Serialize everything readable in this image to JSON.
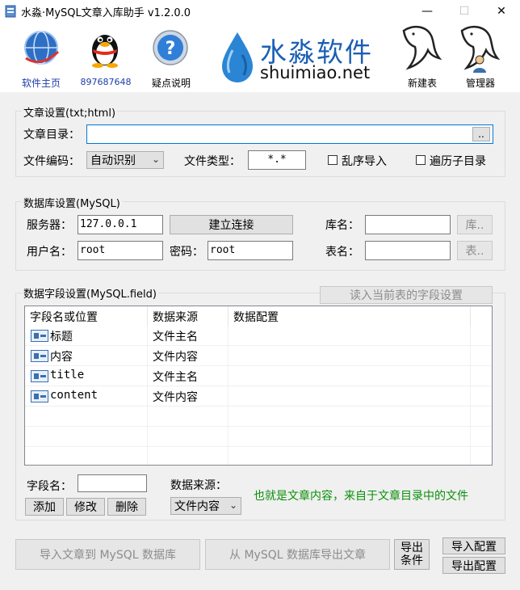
{
  "window": {
    "title": "水淼·MySQL文章入库助手 v1.2.0.0",
    "minimize": "—",
    "maximize": "☐",
    "close": "✕"
  },
  "toolbar": {
    "home_label": "软件主页",
    "qq_label": "897687648",
    "help_label": "疑点说明",
    "brand_cn": "水淼软件",
    "brand_en": "shuimiao.net",
    "new_table_label": "新建表",
    "manager_label": "管理器"
  },
  "article": {
    "group_title": "文章设置(txt;html)",
    "dir_label": "文章目录：",
    "dir_value": "",
    "browse_label": "..",
    "encoding_label": "文件编码：",
    "encoding_value": "自动识别",
    "type_label": "文件类型：",
    "type_value": "*.*",
    "random_label": "乱序导入",
    "subdir_label": "遍历子目录"
  },
  "database": {
    "group_title": "数据库设置(MySQL)",
    "server_label": "服务器：",
    "server_value": "127.0.0.1",
    "connect_label": "建立连接",
    "dbname_label": "库名：",
    "dbname_value": "",
    "db_btn_label": "库..",
    "user_label": "用户名：",
    "user_value": "root",
    "pwd_label": "密码：",
    "pwd_value": "root",
    "table_label": "表名：",
    "table_value": "",
    "table_btn_label": "表.."
  },
  "fields": {
    "group_title": "数据字段设置(MySQL.field)",
    "read_btn_label": "读入当前表的字段设置",
    "columns": [
      "字段名或位置",
      "数据来源",
      "数据配置"
    ],
    "rows": [
      {
        "name": "标题",
        "source": "文件主名",
        "config": ""
      },
      {
        "name": "内容",
        "source": "文件内容",
        "config": ""
      },
      {
        "name": "title",
        "source": "文件主名",
        "config": ""
      },
      {
        "name": "content",
        "source": "文件内容",
        "config": ""
      }
    ],
    "field_name_label": "字段名：",
    "field_name_value": "",
    "source_label": "数据来源：",
    "source_value": "文件内容",
    "add_label": "添加",
    "edit_label": "修改",
    "delete_label": "删除",
    "hint": "也就是文章内容，来自于文章目录中的文件"
  },
  "actions": {
    "import_label": "导入文章到 MySQL 数据库",
    "export_label": "从 MySQL 数据库导出文章",
    "export_cond_line1": "导出",
    "export_cond_line2": "条件",
    "import_config_label": "导入配置",
    "export_config_label": "导出配置"
  },
  "colors": {
    "brand_blue": "#1a5fb4",
    "hint_green": "#0a8f0a",
    "link_blue": "#1a3ea8"
  }
}
